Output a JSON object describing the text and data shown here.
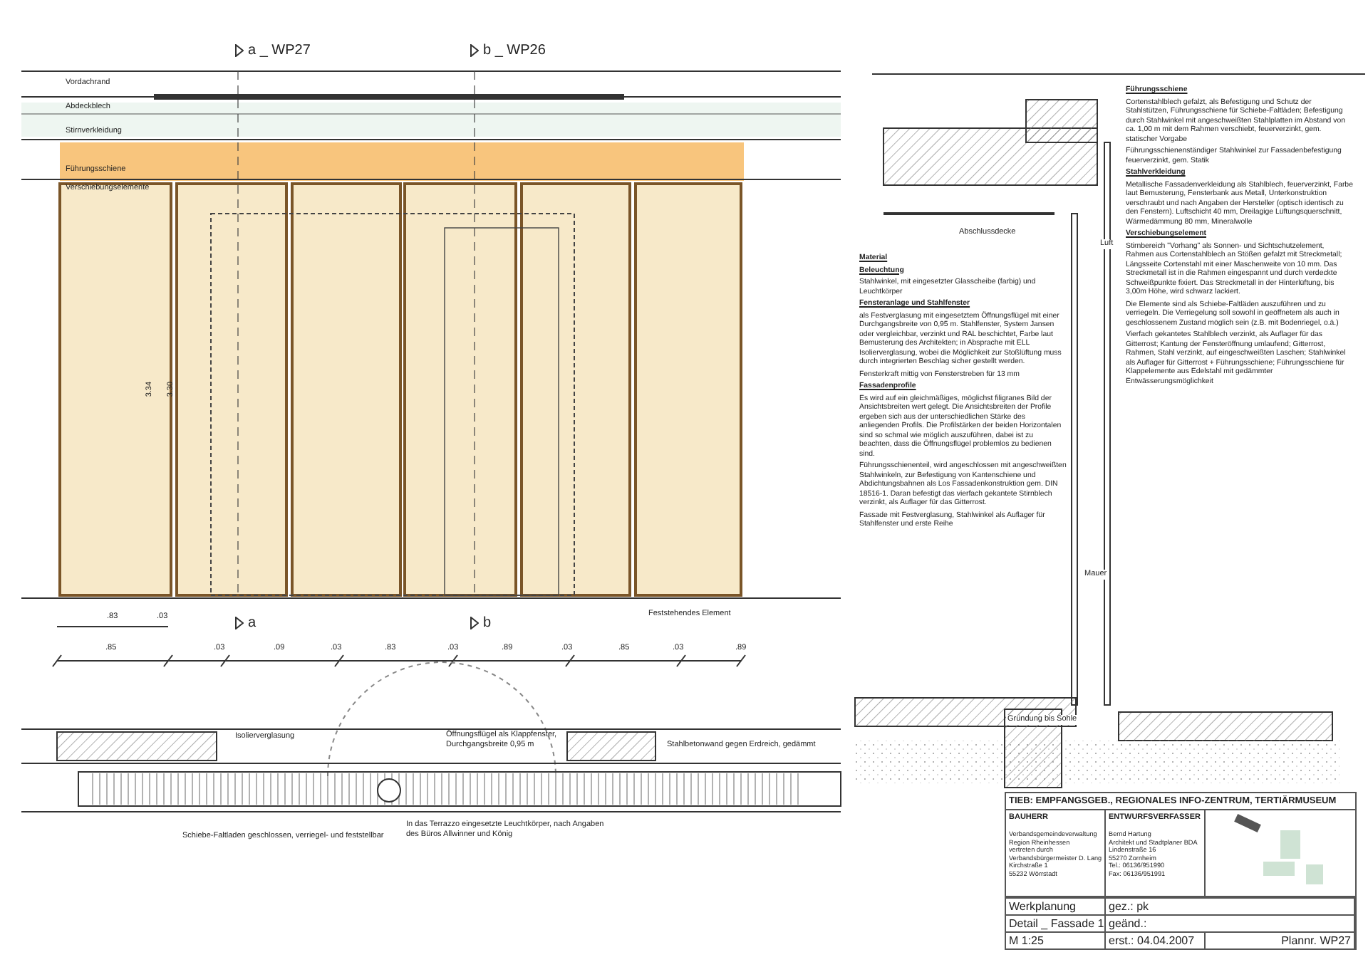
{
  "section_marks": [
    {
      "label": "a _ WP27"
    },
    {
      "label": "b _ WP26"
    }
  ],
  "elevation": {
    "labels": [
      "Vordachrand",
      "Abdeckblech",
      "Stirnverkleidung",
      "Führungsschiene",
      "Verschiebungselemente"
    ],
    "heights": [
      "3.34",
      "3.30"
    ]
  },
  "dimensions": {
    "row_1": [
      ".83",
      ".03"
    ],
    "row_2": [
      ".85",
      ".03",
      ".09",
      ".03",
      ".83",
      ".03",
      ".89",
      ".03",
      ".85",
      ".03",
      ".89"
    ]
  },
  "plan_marks": [
    {
      "label": "a"
    },
    {
      "label": "b"
    }
  ],
  "fixed_element_label": "Feststehendes Element",
  "plan_labels": [
    "Isolierverglasung",
    "Öffnungsflügel als Klappfenster, Durchgangsbreite 0,95 m",
    "Stahlbetonwand gegen Erdreich, gedämmt",
    "Schiebe-Faltladen geschlossen, verriegel- und feststellbar",
    "In das Terrazzo eingesetzte Leuchtkörper, nach Angaben des Büros Allwinner und König"
  ],
  "section_labels": [
    "Abschlussdecke",
    "Luft",
    "Mauer",
    "Gründung bis Sohle"
  ],
  "notes_left": [
    {
      "text": "Material",
      "heading": true
    },
    {
      "text": "Beleuchtung",
      "heading": true
    },
    {
      "text": "Stahlwinkel, mit eingesetzter Glasscheibe (farbig) und Leuchtkörper",
      "heading": false
    },
    {
      "text": "Fensteranlage und Stahlfenster",
      "heading": true
    },
    {
      "text": "als Festverglasung mit eingesetztem Öffnungsflügel mit einer Durchgangsbreite von 0,95 m. Stahlfenster, System Jansen oder vergleichbar, verzinkt und RAL beschichtet, Farbe laut Bemusterung des Architekten; in Absprache mit ELL Isolierverglasung, wobei die Möglichkeit zur Stoßlüftung muss durch integrierten Beschlag sicher gestellt werden.",
      "heading": false
    },
    {
      "text": "Fensterkraft mittig von Fensterstreben für 13 mm",
      "heading": false
    },
    {
      "text": "Fassadenprofile",
      "heading": true
    },
    {
      "text": "Es wird auf ein gleichmäßiges, möglichst filigranes Bild der Ansichtsbreiten wert gelegt. Die Ansichtsbreiten der Profile ergeben sich aus der unterschiedlichen Stärke des anliegenden Profils. Die Profilstärken der beiden Horizontalen sind so schmal wie möglich auszuführen, dabei ist zu beachten, dass die Öffnungsflügel problemlos zu bedienen sind.",
      "heading": false
    },
    {
      "text": "Führungsschienenteil, wird angeschlossen mit angeschweißten Stahlwinkeln, zur Befestigung von Kantenschiene und Abdichtungsbahnen als Los Fassadenkonstruktion gem. DIN 18516-1. Daran befestigt das vierfach gekantete Stirnblech verzinkt, als Auflager für das Gitterrost.",
      "heading": false
    },
    {
      "text": "Fassade mit Festverglasung, Stahlwinkel als Auflager für Stahlfenster und erste Reihe",
      "heading": false
    }
  ],
  "notes_right": [
    {
      "text": "Führungsschiene",
      "heading": true
    },
    {
      "text": "Cortenstahlblech gefalzt, als Befestigung und Schutz der Stahlstützen, Führungsschiene für Schiebe-Faltläden; Befestigung durch Stahlwinkel mit angeschweißten Stahlplatten im Abstand von ca. 1,00 m mit dem Rahmen verschiebt, feuerverzinkt, gem. statischer Vorgabe",
      "heading": false
    },
    {
      "text": "Führungsschienenständiger Stahlwinkel zur Fassadenbefestigung feuerverzinkt, gem. Statik",
      "heading": false
    },
    {
      "text": "Stahlverkleidung",
      "heading": true
    },
    {
      "text": "Metallische Fassadenverkleidung als Stahlblech, feuerverzinkt, Farbe laut Bemusterung, Fensterbank aus Metall, Unterkonstruktion verschraubt und nach Angaben der Hersteller (optisch identisch zu den Fenstern). Luftschicht 40 mm, Dreilagige Lüftungsquerschnitt, Wärmedämmung 80 mm, Mineralwolle",
      "heading": false
    },
    {
      "text": "Verschiebungselement",
      "heading": true
    },
    {
      "text": "Stirnbereich \"Vorhang\" als Sonnen- und Sichtschutzelement, Rahmen aus Cortenstahlblech an Stößen gefalzt mit Streckmetall; Längsseite Cortenstahl mit einer Maschenweite von 10 mm. Das Streckmetall ist in die Rahmen eingespannt und durch verdeckte Schweißpunkte fixiert. Das Streckmetall in der Hinterlüftung, bis 3,00m Höhe, wird schwarz lackiert.",
      "heading": false
    },
    {
      "text": "Die Elemente sind als Schiebe-Faltläden auszuführen und zu verriegeln. Die Verriegelung soll sowohl in geöffnetem als auch in geschlossenem Zustand möglich sein (z.B. mit Bodenriegel, o.ä.)",
      "heading": false
    },
    {
      "text": "Vierfach gekantetes Stahlblech verzinkt, als Auflager für das Gitterrost; Kantung der Fensteröffnung umlaufend; Gitterrost, Rahmen, Stahl verzinkt, auf eingeschweißten Laschen; Stahlwinkel als Auflager für Gitterrost + Führungsschiene; Führungsschiene für Klappelemente aus Edelstahl mit gedämmter Entwässerungsmöglichkeit",
      "heading": false
    }
  ],
  "title_block": {
    "project": "TIEB: EMPFANGSGEB., REGIONALES INFO-ZENTRUM, TERTIÄRMUSEUM",
    "client_heading": "BAUHERR",
    "client_lines": [
      "Verbandsgemeindeverwaltung",
      "Region Rheinhessen",
      "vertreten durch",
      "Verbandsbürgermeister D. Lang",
      "Kirchstraße 1",
      "55232 Wörrstadt"
    ],
    "designer_heading": "ENTWURFSVERFASSER",
    "designer_lines": [
      "Bernd Hartung",
      "Architekt und Stadtplaner BDA",
      "Lindenstraße 16",
      "55270 Zornheim",
      "Tel.: 06136/951990",
      "Fax: 06136/951991"
    ],
    "phase": "Werkplanung",
    "sheet": "Detail _ Fassade 1",
    "scale": "M 1:25",
    "drawn": "gez.: pk",
    "changed": "geänd.:",
    "created": "erst.: 04.04.2007",
    "plan_number": "Plannr. WP27"
  }
}
